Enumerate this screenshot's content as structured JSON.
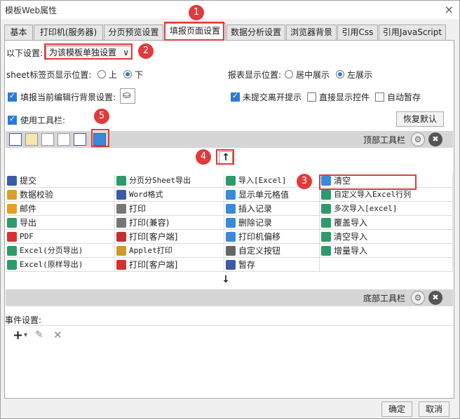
{
  "window": {
    "title": "模板Web属性",
    "close_icon": "×"
  },
  "tabs": [
    {
      "label": "基本"
    },
    {
      "label": "打印机(服务器)"
    },
    {
      "label": "分页预览设置"
    },
    {
      "label": "填报页面设置",
      "active": true
    },
    {
      "label": "数据分析设置"
    },
    {
      "label": "浏览器背景"
    },
    {
      "label": "引用Css"
    },
    {
      "label": "引用JavaScript"
    }
  ],
  "settings": {
    "label": "以下设置:",
    "value": "为该模板单独设置",
    "caret": "∨"
  },
  "sheet_tab": {
    "label": "sheet标签页显示位置:",
    "options": [
      "上",
      "下"
    ],
    "selected": "下"
  },
  "report_pos": {
    "label": "报表显示位置:",
    "options": [
      "居中展示",
      "左展示"
    ],
    "selected": "左展示"
  },
  "fill_bg": {
    "label": "填报当前编辑行背景设置:",
    "checked": true
  },
  "checks": [
    {
      "label": "未提交离开提示",
      "checked": true
    },
    {
      "label": "直接显示控件",
      "checked": false
    },
    {
      "label": "自动暂存",
      "checked": false
    }
  ],
  "use_toolbar": {
    "label": "使用工具栏:",
    "checked": true
  },
  "restore_default": "恢复默认",
  "top_toolbar": {
    "label": "顶部工具栏"
  },
  "bottom_toolbar": {
    "label": "底部工具栏"
  },
  "move_up_icon": "↑",
  "move_down_icon": "↓",
  "items": [
    {
      "label": "提交",
      "icon": "save-icon",
      "color": "#3b5ba8"
    },
    {
      "label": "分页分Sheet导出",
      "icon": "excel-icon",
      "color": "#2e9a6a"
    },
    {
      "label": "导入[Excel]",
      "icon": "excel-icon",
      "color": "#2e9a6a"
    },
    {
      "label": "清空",
      "icon": "eraser-icon",
      "color": "#3a8ad8"
    },
    {
      "label": "数据校验",
      "icon": "check-icon",
      "color": "#d8a22a"
    },
    {
      "label": "Word格式",
      "icon": "word-icon",
      "color": "#3b5ba8"
    },
    {
      "label": "显示单元格值",
      "icon": "cell-icon",
      "color": "#3a8ad8"
    },
    {
      "label": "自定义导入Excel行列",
      "icon": "excel-icon",
      "color": "#2e9a6a"
    },
    {
      "label": "邮件",
      "icon": "mail-icon",
      "color": "#e8a020"
    },
    {
      "label": "打印",
      "icon": "print-icon",
      "color": "#777777"
    },
    {
      "label": "插入记录",
      "icon": "insert-icon",
      "color": "#3a8ad8"
    },
    {
      "label": "多次导入[excel]",
      "icon": "excel-icon",
      "color": "#2e9a6a"
    },
    {
      "label": "导出",
      "icon": "export-icon",
      "color": "#2e9a6a"
    },
    {
      "label": "打印(兼容)",
      "icon": "print-icon",
      "color": "#777777"
    },
    {
      "label": "删除记录",
      "icon": "delete-row-icon",
      "color": "#3a8ad8"
    },
    {
      "label": "覆盖导入",
      "icon": "excel-icon",
      "color": "#2e9a6a"
    },
    {
      "label": "PDF",
      "icon": "pdf-icon",
      "color": "#d83030"
    },
    {
      "label": "打印[客户端]",
      "icon": "print-client-icon",
      "color": "#c33030"
    },
    {
      "label": "打印机偏移",
      "icon": "printer-offset-icon",
      "color": "#3a8ad8"
    },
    {
      "label": "清空导入",
      "icon": "excel-icon",
      "color": "#2e9a6a"
    },
    {
      "label": "Excel(分页导出)",
      "icon": "excel-icon",
      "color": "#2e9a6a"
    },
    {
      "label": "Applet打印",
      "icon": "applet-icon",
      "color": "#c89b2a"
    },
    {
      "label": "自定义按钮",
      "icon": "gear-icon",
      "color": "#666666"
    },
    {
      "label": "增量导入",
      "icon": "excel-icon",
      "color": "#2e9a6a"
    },
    {
      "label": "Excel(原样导出)",
      "icon": "excel-icon",
      "color": "#2e9a6a"
    },
    {
      "label": "打印[客户端]",
      "icon": "pdf-icon",
      "color": "#d83030"
    },
    {
      "label": "暂存",
      "icon": "save-icon",
      "color": "#3b5ba8"
    },
    {
      "label": "",
      "icon": "",
      "color": ""
    }
  ],
  "events": {
    "label": "事件设置:",
    "add_icon": "+",
    "caret": "▾",
    "edit_icon": "✎",
    "delete_icon": "✕"
  },
  "footer": {
    "ok": "确定",
    "cancel": "取消"
  },
  "badges": [
    "1",
    "2",
    "3",
    "4",
    "5"
  ],
  "gear_glyph": "⚙",
  "remove_glyph": "✖"
}
